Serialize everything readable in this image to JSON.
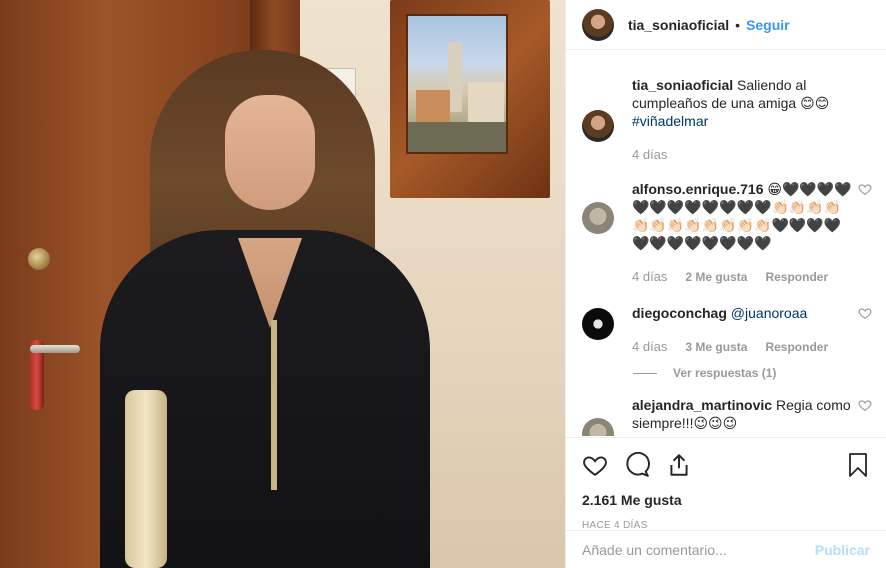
{
  "header": {
    "username": "tia_soniaoficial",
    "separator": "•",
    "follow_label": "Seguir"
  },
  "caption": {
    "username": "tia_soniaoficial",
    "text": "Saliendo al cumpleaños de una amiga 😊😊",
    "hashtag": "#viñadelmar",
    "time": "4 días"
  },
  "comments": [
    {
      "username": "alfonso.enrique.716",
      "text": "😁🖤🖤🖤🖤🖤🖤🖤🖤🖤🖤🖤🖤👏🏻👏🏻👏🏻👏🏻👏🏻👏🏻👏🏻👏🏻👏🏻👏🏻👏🏻👏🏻🖤🖤🖤🖤🖤🖤🖤🖤🖤🖤🖤🖤",
      "time": "4 días",
      "likes": "2 Me gusta",
      "reply": "Responder"
    },
    {
      "username": "diegoconchag",
      "mention": "@juanoroaa",
      "time": "4 días",
      "likes": "3 Me gusta",
      "reply": "Responder",
      "view_replies": "Ver respuestas (1)"
    },
    {
      "username": "alejandra_martinovic",
      "text": "Regia como siempre!!!😉😉😉"
    }
  ],
  "post": {
    "likes": "2.161 Me gusta",
    "time": "HACE 4 DÍAS"
  },
  "add_comment": {
    "placeholder": "Añade un comentario...",
    "publish_label": "Publicar"
  }
}
